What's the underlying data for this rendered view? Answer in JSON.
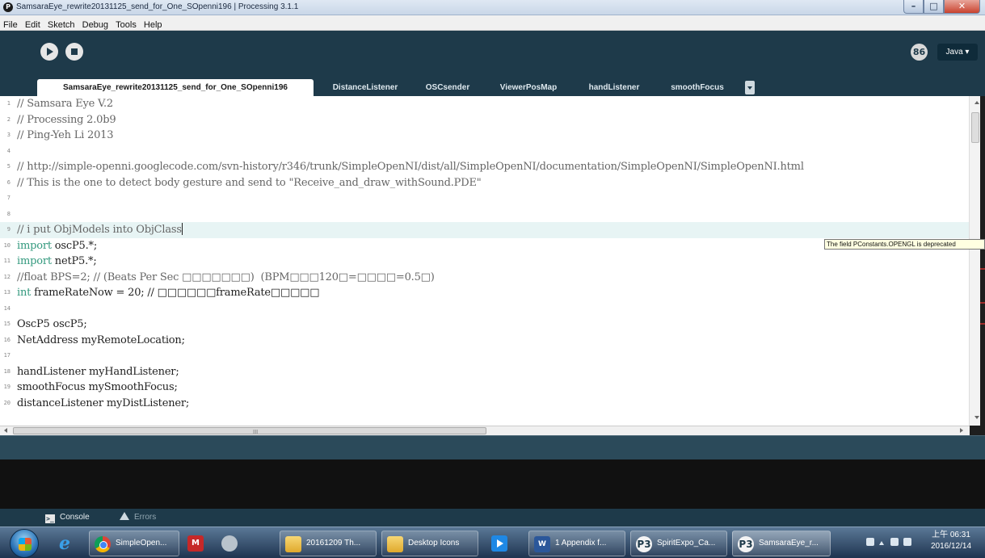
{
  "window": {
    "title": "SamsaraEye_rewrite20131125_send_for_One_SOpenni196 | Processing 3.1.1",
    "minimize": "–",
    "maximize": "□",
    "close": "✕"
  },
  "menu": [
    "File",
    "Edit",
    "Sketch",
    "Debug",
    "Tools",
    "Help"
  ],
  "toolbar": {
    "run_icon": "play-icon",
    "stop_icon": "stop-icon",
    "debug_label": "86",
    "mode_label": "Java ▾"
  },
  "tabs": [
    {
      "label": "SamsaraEye_rewrite20131125_send_for_One_SOpenni196",
      "active": true
    },
    {
      "label": "DistanceListener"
    },
    {
      "label": "OSCsender"
    },
    {
      "label": "ViewerPosMap"
    },
    {
      "label": "handListener"
    },
    {
      "label": "smoothFocus"
    }
  ],
  "editor": {
    "current_line": 9,
    "lines": [
      {
        "num": "1",
        "parts": [
          {
            "t": "// Samsara Eye V.2",
            "c": "cm"
          }
        ]
      },
      {
        "num": "2",
        "parts": [
          {
            "t": "// Processing 2.0b9",
            "c": "cm"
          }
        ]
      },
      {
        "num": "3",
        "parts": [
          {
            "t": "// Ping-Yeh Li 2013",
            "c": "cm"
          }
        ]
      },
      {
        "num": "4",
        "parts": []
      },
      {
        "num": "5",
        "parts": [
          {
            "t": "// http://simple-openni.googlecode.com/svn-history/r346/trunk/SimpleOpenNI/dist/all/SimpleOpenNI/documentation/SimpleOpenNI/SimpleOpenNI.html",
            "c": "cm"
          }
        ]
      },
      {
        "num": "6",
        "parts": [
          {
            "t": "// This is the one to detect body gesture and send to \"Receive_and_draw_withSound.PDE\"",
            "c": "cm"
          }
        ]
      },
      {
        "num": "7",
        "parts": []
      },
      {
        "num": "8",
        "parts": []
      },
      {
        "num": "9",
        "parts": [
          {
            "t": "// i put ObjModels into ObjClass",
            "c": "cm"
          }
        ]
      },
      {
        "num": "10",
        "parts": [
          {
            "t": "import",
            "c": "kw"
          },
          {
            "t": " oscP5.*;",
            "c": ""
          }
        ]
      },
      {
        "num": "11",
        "parts": [
          {
            "t": "import",
            "c": "kw"
          },
          {
            "t": " netP5.*;",
            "c": ""
          }
        ]
      },
      {
        "num": "12",
        "parts": [
          {
            "t": "//float BPS=2; // (Beats Per Sec □□□□□□□)  (BPM□□□120□=□□□□=0.5□)",
            "c": "cm"
          }
        ]
      },
      {
        "num": "13",
        "parts": [
          {
            "t": "int",
            "c": "kw"
          },
          {
            "t": " frameRateNow = 20; // □□□□□□frameRate□□□□□",
            "c": ""
          }
        ]
      },
      {
        "num": "14",
        "parts": []
      },
      {
        "num": "15",
        "parts": [
          {
            "t": "OscP5 oscP5;",
            "c": ""
          }
        ]
      },
      {
        "num": "16",
        "parts": [
          {
            "t": "NetAddress myRemoteLocation;",
            "c": ""
          }
        ]
      },
      {
        "num": "17",
        "parts": []
      },
      {
        "num": "18",
        "parts": [
          {
            "t": "handListener myHandListener;",
            "c": ""
          }
        ]
      },
      {
        "num": "19",
        "parts": [
          {
            "t": "smoothFocus mySmoothFocus;",
            "c": ""
          }
        ]
      },
      {
        "num": "20",
        "parts": [
          {
            "t": "distanceListener myDistListener;",
            "c": ""
          }
        ]
      }
    ],
    "tooltip": "The field PConstants.OPENGL is deprecated",
    "hscroll_grip": "III"
  },
  "console": {
    "tab_console": "Console",
    "tab_errors": "Errors"
  },
  "taskbar": {
    "items": [
      {
        "label": "",
        "icon": "ie-icon",
        "kind": "pinned"
      },
      {
        "label": "SimpleOpen...",
        "icon": "chrome-icon",
        "kind": "window"
      },
      {
        "label": "",
        "icon": "app-red-icon",
        "kind": "pinned"
      },
      {
        "label": "",
        "icon": "app-gray-icon",
        "kind": "pinned"
      },
      {
        "label": "20161209 Th...",
        "icon": "folder-icon",
        "kind": "window"
      },
      {
        "label": "Desktop Icons",
        "icon": "folder-icon",
        "kind": "window"
      },
      {
        "label": "",
        "icon": "media-icon",
        "kind": "pinned"
      },
      {
        "label": "1 Appendix f...",
        "icon": "word-icon",
        "kind": "window"
      },
      {
        "label": "SpiritExpo_Ca...",
        "icon": "processing-icon",
        "kind": "window"
      },
      {
        "label": "SamsaraEye_r...",
        "icon": "processing-icon",
        "kind": "window",
        "active": true
      }
    ],
    "clock_time": "上午 06:31",
    "clock_date": "2016/12/14"
  }
}
